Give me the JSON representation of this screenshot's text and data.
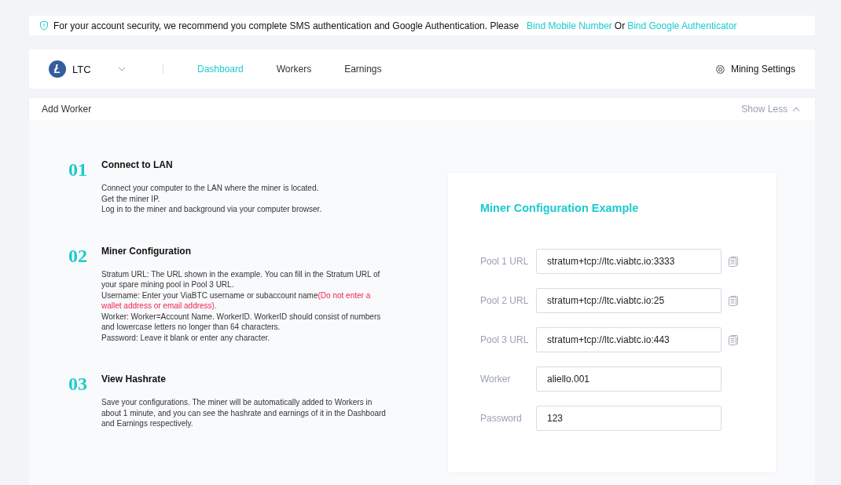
{
  "notice": {
    "text": "For your account security, we recommend you complete SMS authentication and Google Authentication. Please",
    "links": [
      "Bind Mobile Number",
      "Bind Google Authenticator"
    ],
    "joiner": "Or"
  },
  "nav": {
    "coin": "LTC",
    "tabs": [
      {
        "label": "Dashboard",
        "selected": true
      },
      {
        "label": "Workers",
        "selected": false
      },
      {
        "label": "Earnings",
        "selected": false
      }
    ],
    "settings": "Mining Settings"
  },
  "section": {
    "title": "Add Worker",
    "toggle": "Show Less"
  },
  "steps": [
    {
      "number": "01",
      "title": "Connect to LAN",
      "lines": [
        {
          "text": "Connect your computer to the LAN where the miner is located."
        },
        {
          "text": "Get the miner IP."
        },
        {
          "text": "Log in to the miner and background via your computer browser."
        }
      ]
    },
    {
      "number": "02",
      "title": "Miner Configuration",
      "lines": [
        {
          "text": "Stratum URL: The URL shown in the example. You can fill in the Stratum URL of your spare mining pool in Pool 3 URL."
        },
        {
          "text": "Username: Enter your ViaBTC username or subaccount name",
          "warning": "(Do not enter a wallet address or email address)."
        },
        {
          "text": "Worker: Worker=Account Name. WorkerID. WorkerID should consist of numbers and lowercase letters no longer than 64 characters."
        },
        {
          "text": "Password: Leave it blank or enter any character."
        }
      ]
    },
    {
      "number": "03",
      "title": "View Hashrate",
      "lines": [
        {
          "text": "Save your configurations. The miner will be automatically added to Workers in about 1 minute, and you can see the hashrate and earnings of it in the Dashboard and Earnings respectively."
        }
      ]
    }
  ],
  "example": {
    "title": "Miner Configuration Example",
    "fields": [
      {
        "label": "Pool 1 URL",
        "value": "stratum+tcp://ltc.viabtc.io:3333",
        "copyable": true
      },
      {
        "label": "Pool 2 URL",
        "value": "stratum+tcp://ltc.viabtc.io:25",
        "copyable": true
      },
      {
        "label": "Pool 3 URL",
        "value": "stratum+tcp://ltc.viabtc.io:443",
        "copyable": true
      },
      {
        "label": "Worker",
        "value": "aliello.001",
        "copyable": false
      },
      {
        "label": "Password",
        "value": "123",
        "copyable": false
      }
    ]
  }
}
